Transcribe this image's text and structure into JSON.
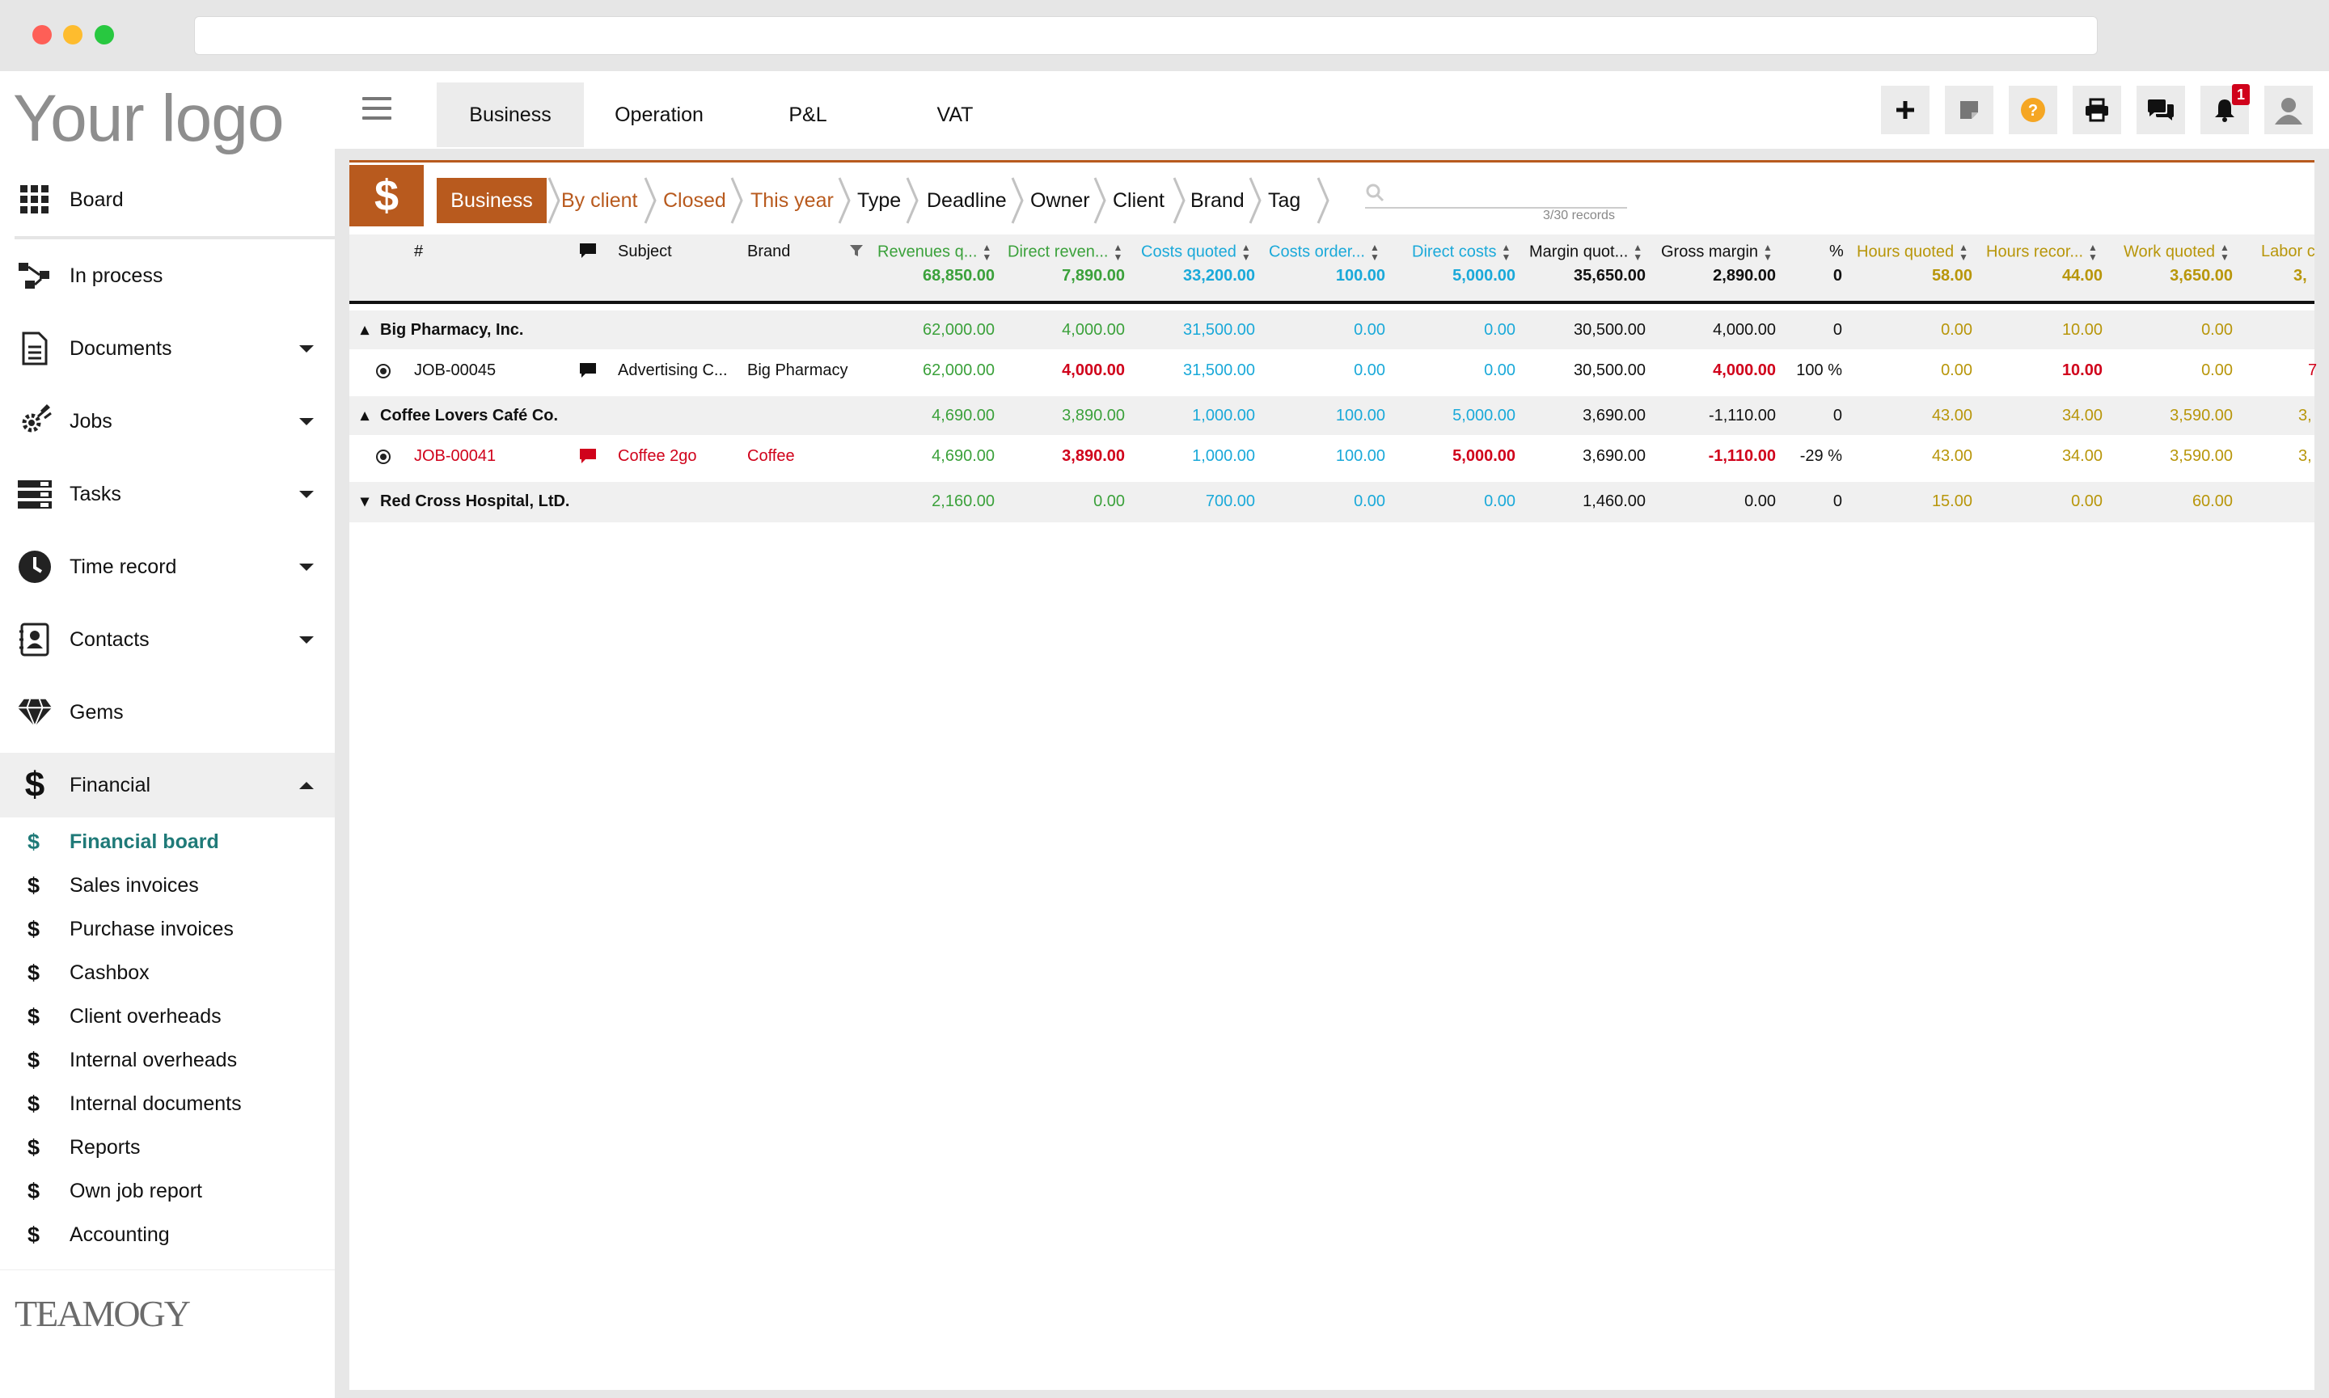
{
  "sidebar": {
    "logo": "Your logo",
    "items": [
      {
        "label": "Board"
      },
      {
        "label": "In process"
      },
      {
        "label": "Documents"
      },
      {
        "label": "Jobs"
      },
      {
        "label": "Tasks"
      },
      {
        "label": "Time record"
      },
      {
        "label": "Contacts"
      },
      {
        "label": "Gems"
      },
      {
        "label": "Financial"
      }
    ],
    "financial_subitems": [
      {
        "label": "Financial board"
      },
      {
        "label": "Sales invoices"
      },
      {
        "label": "Purchase invoices"
      },
      {
        "label": "Cashbox"
      },
      {
        "label": "Client overheads"
      },
      {
        "label": "Internal overheads"
      },
      {
        "label": "Internal documents"
      },
      {
        "label": "Reports"
      },
      {
        "label": "Own job report"
      },
      {
        "label": "Accounting"
      }
    ],
    "brand": "TEAMOGY"
  },
  "tabs": [
    {
      "label": "Business"
    },
    {
      "label": "Operation"
    },
    {
      "label": "P&L"
    },
    {
      "label": "VAT"
    }
  ],
  "toolbar": {
    "notification_count": "1",
    "accent_color": "#b85a1e"
  },
  "header_badge": "$",
  "breadcrumb": [
    "Business",
    "By client",
    "Closed",
    "This year",
    "Type",
    "Deadline",
    "Owner",
    "Client",
    "Brand",
    "Tag"
  ],
  "search": {
    "records": "3/30 records"
  },
  "table": {
    "columns": [
      "#",
      "Subject",
      "Brand",
      "Revenues q...",
      "Direct reven...",
      "Costs quoted",
      "Costs order...",
      "Direct costs",
      "Margin quot...",
      "Gross margin",
      "%",
      "Hours quoted",
      "Hours recor...",
      "Work quoted",
      "Labor c"
    ],
    "totals": [
      "68,850.00",
      "7,890.00",
      "33,200.00",
      "100.00",
      "5,000.00",
      "35,650.00",
      "2,890.00",
      "0",
      "58.00",
      "44.00",
      "3,650.00",
      "3,"
    ],
    "groups": [
      {
        "name": "Big Pharmacy, Inc.",
        "values": [
          "62,000.00",
          "4,000.00",
          "31,500.00",
          "0.00",
          "0.00",
          "30,500.00",
          "4,000.00",
          "0",
          "0.00",
          "10.00",
          "0.00"
        ],
        "job": {
          "id": "JOB-00045",
          "subject": "Advertising C...",
          "brand": "Big Pharmacy",
          "values": [
            "62,000.00",
            "4,000.00",
            "31,500.00",
            "0.00",
            "0.00",
            "30,500.00",
            "4,000.00",
            "100 %",
            "0.00",
            "10.00",
            "0.00",
            "7"
          ]
        }
      },
      {
        "name": "Coffee Lovers Café Co.",
        "values": [
          "4,690.00",
          "3,890.00",
          "1,000.00",
          "100.00",
          "5,000.00",
          "3,690.00",
          "-1,110.00",
          "0",
          "43.00",
          "34.00",
          "3,590.00",
          "3,"
        ],
        "job": {
          "id": "JOB-00041",
          "subject": "Coffee 2go",
          "brand": "Coffee",
          "values": [
            "4,690.00",
            "3,890.00",
            "1,000.00",
            "100.00",
            "5,000.00",
            "3,690.00",
            "-1,110.00",
            "-29 %",
            "43.00",
            "34.00",
            "3,590.00",
            "3,"
          ]
        }
      },
      {
        "name": "Red Cross Hospital, LtD.",
        "values": [
          "2,160.00",
          "0.00",
          "700.00",
          "0.00",
          "0.00",
          "1,460.00",
          "0.00",
          "0",
          "15.00",
          "0.00",
          "60.00"
        ]
      }
    ]
  }
}
